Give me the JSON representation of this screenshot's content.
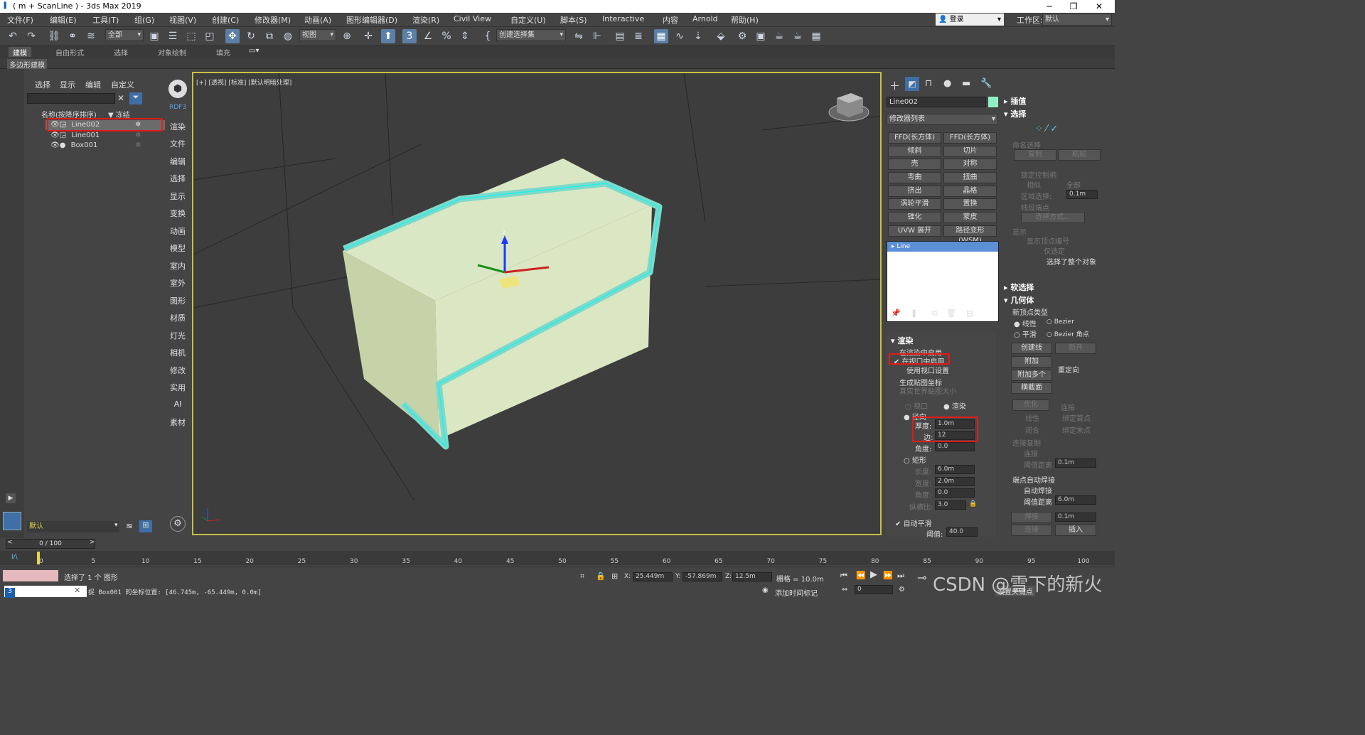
{
  "window": {
    "title": "( m + ScanLine ) - 3ds Max 2019"
  },
  "menu": [
    "文件(F)",
    "编辑(E)",
    "工具(T)",
    "组(G)",
    "视图(V)",
    "创建(C)",
    "修改器(M)",
    "动画(A)",
    "图形编辑器(D)",
    "渲染(R)",
    "Civil View",
    "自定义(U)",
    "脚本(S)",
    "Interactive",
    "内容",
    "Arnold",
    "帮助(H)"
  ],
  "header": {
    "login": "登录",
    "workspace_label": "工作区:",
    "workspace_value": "默认"
  },
  "toolbar": {
    "filter": "全部",
    "view": "视图",
    "selection_set": "创建选择集"
  },
  "ribbon": {
    "tabs": [
      "建模",
      "自由形式",
      "选择",
      "对象绘制",
      "填充"
    ],
    "sub": "多边形建模"
  },
  "scene_explorer": {
    "menus": [
      "选择",
      "显示",
      "编辑",
      "自定义"
    ],
    "col_name": "名称(按降序排序)",
    "col_freeze": "▼ 冻结",
    "items": [
      "Line002",
      "Line001",
      "Box001"
    ],
    "layer": "默认"
  },
  "side_tabs": [
    "RDF3",
    "渲染",
    "文件",
    "编辑",
    "选择",
    "显示",
    "变换",
    "动画",
    "模型",
    "室内",
    "室外",
    "图形",
    "材质",
    "灯光",
    "相机",
    "修改",
    "实用",
    "AI",
    "素材"
  ],
  "viewport": {
    "label": "[+] [透视] [标准] [默认明暗处理]"
  },
  "modify": {
    "object_name": "Line002",
    "modifier_list": "修改器列表",
    "buttons": [
      "FFD(长方体)",
      "FFD(长方体)",
      "倾斜",
      "切片",
      "壳",
      "对称",
      "弯曲",
      "扭曲",
      "挤出",
      "晶格",
      "涡轮平滑",
      "置换",
      "锥化",
      "蒙皮",
      "UVW 展开",
      "路径变形 (WSM)"
    ],
    "stack_item": "Line",
    "rendering": {
      "title": "渲染",
      "enable_render": "在渲染中启用",
      "enable_viewport": "在视口中启用",
      "use_viewport": "使用视口设置",
      "gen_mapping": "生成贴图坐标",
      "real_world": "真实世界贴图大小",
      "viewport_opt": "视口",
      "render_opt": "渲染",
      "radial": "径向",
      "thickness_label": "厚度:",
      "thickness": "1.0m",
      "sides_label": "边:",
      "sides": "12",
      "angle_label": "角度:",
      "angle": "0.0",
      "rect": "矩形",
      "length_label": "长度:",
      "length": "6.0m",
      "width_label": "宽度:",
      "width": "2.0m",
      "angle2_label": "角度:",
      "angle2": "0.0",
      "aspect_label": "纵横比:",
      "aspect": "3.0",
      "auto_smooth": "自动平滑",
      "threshold_label": "阈值:",
      "threshold": "40.0"
    }
  },
  "right_panel": {
    "interp": "插值",
    "select": "选择",
    "named_sel": "命名选择",
    "copy": "复制",
    "paste": "粘贴",
    "lock_handles": "锁定控制柄",
    "similar": "相似",
    "all": "全部",
    "area_sel": "区域选择:",
    "area_val": "0.1m",
    "seg_end": "线段端点",
    "sel_method": "选择方式...",
    "display": "显示",
    "show_vertex_num": "显示顶点编号",
    "only_sel": "仅选定",
    "sel_whole": "选择了整个对象",
    "soft_sel": "软选择",
    "geometry": "几何体",
    "new_vertex_type": "新顶点类型",
    "linear": "线性",
    "bezier": "Bezier",
    "smooth": "平滑",
    "bezier_corner": "Bezier 角点",
    "create_line": "创建线",
    "break": "断开",
    "attach": "附加",
    "reorient": "重定向",
    "attach_multi": "附加多个",
    "cross_section": "横截面",
    "optimize": "优化",
    "connect": "连接",
    "linear2": "线性",
    "bind_first": "绑定首点",
    "closed": "闭合",
    "bind_last": "绑定末点",
    "conn_copy": "连接复制",
    "connect2": "连接",
    "thresh_dist": "阈值距离",
    "thresh_val": "0.1m",
    "end_weld": "端点自动焊接",
    "auto_weld": "自动焊接",
    "thresh_dist2": "阈值距离",
    "thresh_val2": "6.0m",
    "weld": "焊接",
    "weld_val": "0.1m",
    "connect3": "连接",
    "insert": "插入"
  },
  "timeline": {
    "frame": "0 / 100",
    "ticks": [
      "0",
      "5",
      "10",
      "15",
      "20",
      "25",
      "30",
      "35",
      "40",
      "45",
      "50",
      "55",
      "60",
      "65",
      "70",
      "75",
      "80",
      "85",
      "90",
      "95",
      "100"
    ]
  },
  "status": {
    "selected": "选择了 1 个 图形",
    "coords_msg": "捉 Box001 的坐标位置: [46.745m, -65.449m, 0.0m]",
    "x_label": "X:",
    "x": "25.449m",
    "y_label": "Y:",
    "y": "-57.869m",
    "z_label": "Z:",
    "z": "12.5m",
    "grid": "栅格 = 10.0m",
    "add_time_tag": "添加时间标记",
    "frame_field": "0",
    "watermark": "CSDN @雪下的新火",
    "set_key": "设置关键点"
  }
}
